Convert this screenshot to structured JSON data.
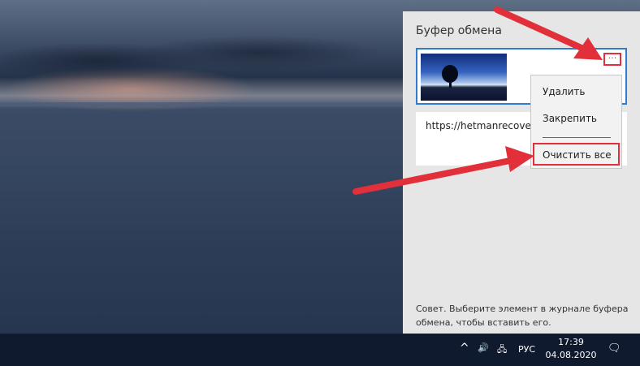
{
  "clipboard": {
    "title": "Буфер обмена",
    "url_item": "https://hetmanrecovery.c",
    "more_label": "···",
    "tip": "Совет. Выберите элемент в журнале буфера обмена, чтобы вставить его."
  },
  "menu": {
    "delete": "Удалить",
    "pin": "Закрепить",
    "clear_all": "Очистить все"
  },
  "taskbar": {
    "chevron": "^",
    "volume": "🔊",
    "network": "🖧",
    "lang": "РУС",
    "time": "17:39",
    "date": "04.08.2020",
    "notifications": "🗨"
  },
  "colors": {
    "highlight": "#e1303a",
    "selection": "#2e7bd1"
  }
}
